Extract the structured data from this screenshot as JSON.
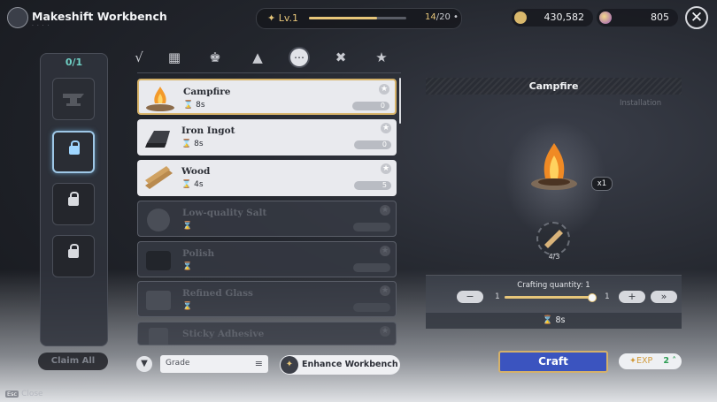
{
  "header": {
    "title": "Makeshift Workbench",
    "subtitle": "· · · ·",
    "level_label": "Lv.1",
    "level_progress": 0.7,
    "level_current": "14",
    "level_total": "/20",
    "currency_gold": "430,582",
    "currency_gem": "805"
  },
  "slots": {
    "count_used": "0",
    "count_total": "/1",
    "claim_all_label": "Claim All"
  },
  "tabs": [
    {
      "icon": "tool-icon"
    },
    {
      "icon": "scroll-icon"
    },
    {
      "icon": "helmet-icon"
    },
    {
      "icon": "tent-icon"
    },
    {
      "icon": "more-icon",
      "active": true
    },
    {
      "icon": "bone-icon"
    },
    {
      "icon": "star-icon"
    }
  ],
  "recipes": [
    {
      "name": "Campfire",
      "time": "8s",
      "owned": "0",
      "state": "enabled",
      "selected": true
    },
    {
      "name": "Iron Ingot",
      "time": "8s",
      "owned": "0",
      "state": "enabled"
    },
    {
      "name": "Wood",
      "time": "4s",
      "owned": "5",
      "state": "enabled"
    },
    {
      "name": "Low-quality Salt",
      "time": "",
      "owned": "",
      "state": "disabled"
    },
    {
      "name": "Polish",
      "time": "",
      "owned": "",
      "state": "disabled"
    },
    {
      "name": "Refined Glass",
      "time": "",
      "owned": "",
      "state": "disabled"
    },
    {
      "name": "Sticky Adhesive",
      "time": "",
      "owned": "",
      "state": "disabled"
    }
  ],
  "list_footer": {
    "grade_label": "Grade",
    "enhance_label": "Enhance Workbench"
  },
  "detail": {
    "title": "Campfire",
    "type": "Installation",
    "yield": "x1",
    "material_count": "4/3",
    "quantity_label": "Crafting quantity: 1",
    "qty_min": "1",
    "qty_max": "1",
    "qty_progress": 1.0,
    "craft_time": "8s",
    "craft_label": "Craft",
    "exp_label": "EXP",
    "exp_value": "2"
  },
  "footer": {
    "esc_key": "Esc",
    "esc_label": "Close"
  }
}
